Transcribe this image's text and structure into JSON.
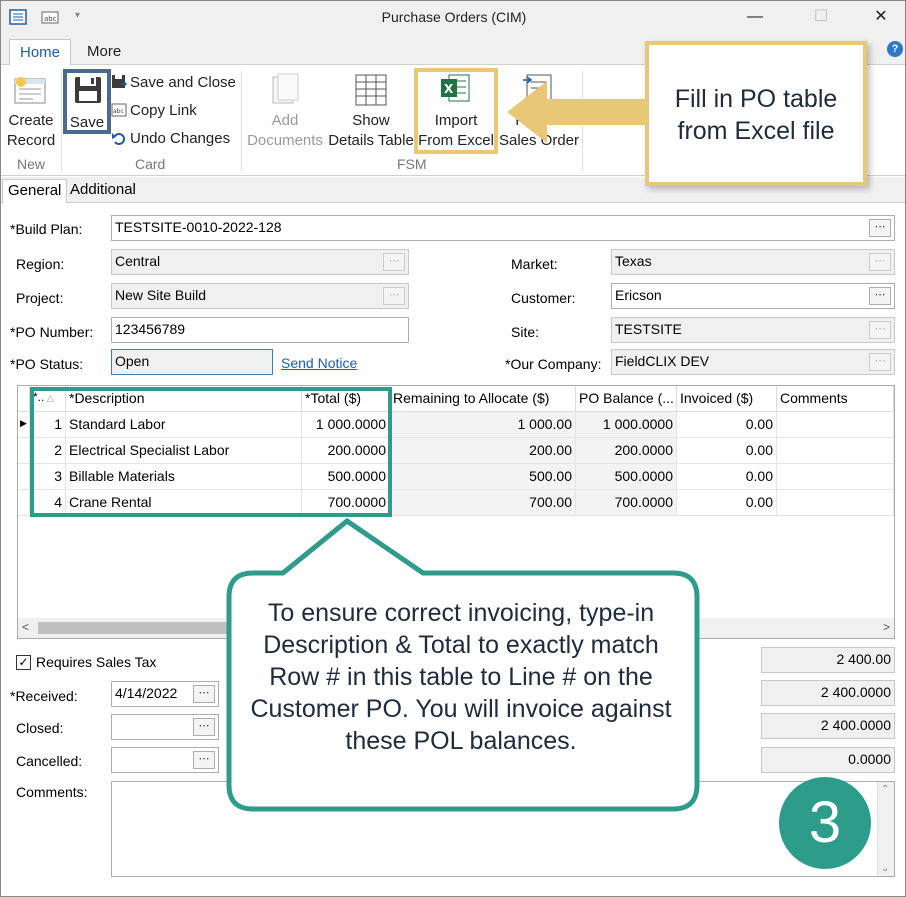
{
  "window": {
    "title": "Purchase Orders (CIM)"
  },
  "ribbon": {
    "tabs": [
      "Home",
      "More"
    ],
    "help_label": "?",
    "new_group": {
      "label": "New",
      "create_record": [
        "Create",
        "Record"
      ]
    },
    "card_group": {
      "label": "Card",
      "save": "Save",
      "save_and_close": "Save and Close",
      "copy_link": "Copy Link",
      "undo_changes": "Undo Changes"
    },
    "fsm_group": {
      "label": "FSM",
      "add_documents": [
        "Add",
        "Documents"
      ],
      "show_details_table": [
        "Show",
        "Details Table"
      ],
      "import_from_excel": [
        "Import",
        "From Excel"
      ],
      "fill_out_sales_order": [
        "Fill Out",
        "Sales Order"
      ]
    }
  },
  "form_tabs": [
    "General",
    "Additional"
  ],
  "form": {
    "build_plan": {
      "label": "*Build Plan:",
      "value": "TESTSITE-0010-2022-128"
    },
    "region": {
      "label": "Region:",
      "value": "Central"
    },
    "project": {
      "label": "Project:",
      "value": "New Site Build"
    },
    "po_number": {
      "label": "*PO Number:",
      "value": "123456789"
    },
    "po_status": {
      "label": "*PO Status:",
      "value": "Open"
    },
    "send_notice": "Send Notice",
    "market": {
      "label": "Market:",
      "value": "Texas"
    },
    "customer": {
      "label": "Customer:",
      "value": "Ericson"
    },
    "site": {
      "label": "Site:",
      "value": "TESTSITE"
    },
    "our_company": {
      "label": "*Our Company:",
      "value": "FieldCLIX DEV"
    },
    "requires_sales_tax": {
      "label": "Requires Sales Tax",
      "checked": true
    },
    "received": {
      "label": "*Received:",
      "value": "4/14/2022"
    },
    "closed": {
      "label": "Closed:",
      "value": ""
    },
    "cancelled": {
      "label": "Cancelled:",
      "value": ""
    },
    "comments_label": "Comments:",
    "summary_values": [
      "2 400.00",
      "2 400.0000",
      "2 400.0000",
      "0.0000"
    ]
  },
  "grid": {
    "columns": [
      "*..",
      "*Description",
      "*Total ($)",
      "Remaining to Allocate ($)",
      "PO Balance (...",
      "Invoiced ($)",
      "Comments"
    ],
    "rows": [
      {
        "num": "1",
        "description": "Standard Labor",
        "total": "1 000.0000",
        "remaining": "1 000.00",
        "balance": "1 000.0000",
        "invoiced": "0.00",
        "comments": ""
      },
      {
        "num": "2",
        "description": "Electrical Specialist Labor",
        "total": "200.0000",
        "remaining": "200.00",
        "balance": "200.0000",
        "invoiced": "0.00",
        "comments": ""
      },
      {
        "num": "3",
        "description": "Billable Materials",
        "total": "500.0000",
        "remaining": "500.00",
        "balance": "500.0000",
        "invoiced": "0.00",
        "comments": ""
      },
      {
        "num": "4",
        "description": "Crane Rental",
        "total": "700.0000",
        "remaining": "700.00",
        "balance": "700.0000",
        "invoiced": "0.00",
        "comments": ""
      }
    ]
  },
  "annotations": {
    "excel_callout": "Fill in PO table from Excel file",
    "invoice_callout": "To ensure correct invoicing, type-in Description & Total to exactly match Row # in this table to Line # on the Customer PO. You will invoice against these POL balances.",
    "step_badge": "3"
  },
  "colors": {
    "accent_gold": "#e8c876",
    "accent_teal": "#2d9c8a",
    "link_blue": "#1a5fb4"
  }
}
